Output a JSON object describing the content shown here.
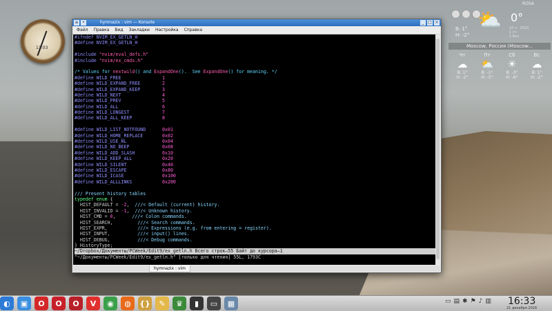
{
  "window": {
    "title": "hymnazix : vim — Konsole",
    "menu": [
      "Файл",
      "Правка",
      "Вид",
      "Закладки",
      "Настройка",
      "Справка"
    ],
    "tab_label": "hymnazix : vim"
  },
  "terminal": {
    "lines": [
      [
        [
          "#ifndef NVIM_EX_GETLN_H",
          "pp"
        ]
      ],
      [
        [
          "#define NVIM_EX_GETLN_H",
          "pp"
        ]
      ],
      [
        [
          "",
          ""
        ]
      ],
      [
        [
          "#include ",
          "pp"
        ],
        [
          "\"nvim/eval_defs.h\"",
          "fn"
        ]
      ],
      [
        [
          "#include ",
          "pp"
        ],
        [
          "\"nvim/ex_cmds.h\"",
          "fn"
        ]
      ],
      [
        [
          "",
          ""
        ]
      ],
      [
        [
          "/* Values for ",
          "comment"
        ],
        [
          "nextwild",
          "fn"
        ],
        [
          "() and ",
          "comment"
        ],
        [
          "ExpandOne",
          "fn"
        ],
        [
          "().  See ",
          "comment"
        ],
        [
          "ExpandOne",
          "fn"
        ],
        [
          "() for meaning. */",
          "comment"
        ]
      ],
      [
        [
          "#define WILD_FREE               ",
          "pp"
        ],
        [
          "1",
          "num"
        ]
      ],
      [
        [
          "#define WILD_EXPAND_FREE        ",
          "pp"
        ],
        [
          "2",
          "num"
        ]
      ],
      [
        [
          "#define WILD_EXPAND_KEEP        ",
          "pp"
        ],
        [
          "3",
          "num"
        ]
      ],
      [
        [
          "#define WILD_NEXT               ",
          "pp"
        ],
        [
          "4",
          "num"
        ]
      ],
      [
        [
          "#define WILD_PREV               ",
          "pp"
        ],
        [
          "5",
          "num"
        ]
      ],
      [
        [
          "#define WILD_ALL                ",
          "pp"
        ],
        [
          "6",
          "num"
        ]
      ],
      [
        [
          "#define WILD_LONGEST            ",
          "pp"
        ],
        [
          "7",
          "num"
        ]
      ],
      [
        [
          "#define WILD_ALL_KEEP           ",
          "pp"
        ],
        [
          "8",
          "num"
        ]
      ],
      [
        [
          "",
          ""
        ]
      ],
      [
        [
          "#define WILD_LIST_NOTFOUND      ",
          "pp"
        ],
        [
          "0x01",
          "num"
        ]
      ],
      [
        [
          "#define WILD_HOME_REPLACE       ",
          "pp"
        ],
        [
          "0x02",
          "num"
        ]
      ],
      [
        [
          "#define WILD_USE_NL             ",
          "pp"
        ],
        [
          "0x04",
          "num"
        ]
      ],
      [
        [
          "#define WILD_NO_BEEP            ",
          "pp"
        ],
        [
          "0x08",
          "num"
        ]
      ],
      [
        [
          "#define WILD_ADD_SLASH          ",
          "pp"
        ],
        [
          "0x10",
          "num"
        ]
      ],
      [
        [
          "#define WILD_KEEP_ALL           ",
          "pp"
        ],
        [
          "0x20",
          "num"
        ]
      ],
      [
        [
          "#define WILD_SILENT             ",
          "pp"
        ],
        [
          "0x40",
          "num"
        ]
      ],
      [
        [
          "#define WILD_ESCAPE             ",
          "pp"
        ],
        [
          "0x80",
          "num"
        ]
      ],
      [
        [
          "#define WILD_ICASE              ",
          "pp"
        ],
        [
          "0x100",
          "num"
        ]
      ],
      [
        [
          "#define WILD_ALLLINKS           ",
          "pp"
        ],
        [
          "0x200",
          "num"
        ]
      ],
      [
        [
          "",
          ""
        ]
      ],
      [
        [
          "/// Present history tables",
          "doc"
        ]
      ],
      [
        [
          "typedef ",
          "type"
        ],
        [
          "enum ",
          "type"
        ],
        [
          "{",
          "id"
        ]
      ],
      [
        [
          "  HIST_DEFAULT = ",
          "id"
        ],
        [
          "-2",
          "num"
        ],
        [
          ",  ",
          "id"
        ],
        [
          "///< Default (current) history.",
          "doc"
        ]
      ],
      [
        [
          "  HIST_INVALID = ",
          "id"
        ],
        [
          "-1",
          "num"
        ],
        [
          ",  ",
          "id"
        ],
        [
          "///< Unknown history.",
          "doc"
        ]
      ],
      [
        [
          "  HIST_CMD = ",
          "id"
        ],
        [
          "0",
          "num"
        ],
        [
          ",      ",
          "id"
        ],
        [
          "///< Colon commands.",
          "doc"
        ]
      ],
      [
        [
          "  HIST_SEARCH,         ",
          "id"
        ],
        [
          "///< Search commands.",
          "doc"
        ]
      ],
      [
        [
          "  HIST_EXPR,           ",
          "id"
        ],
        [
          "///< Expressions (e.g. from entering = register).",
          "doc"
        ]
      ],
      [
        [
          "  HIST_INPUT,          ",
          "id"
        ],
        [
          "///< input() lines.",
          "doc"
        ]
      ],
      [
        [
          "  HIST_DEBUG,          ",
          "id"
        ],
        [
          "///< Debug commands.",
          "doc"
        ]
      ],
      [
        [
          "} HistoryType;",
          "id"
        ]
      ]
    ],
    "status_line": "~/Dropbox/Документы/PCWeek/Edit9/ex_getln.h Всего строк—55 Байт до курсора—1",
    "cmd_line": "\"~/Документы/PCWeek/Edit9/ex_getln.h\" [только для чтения] 55L, 1793C"
  },
  "weather": {
    "current_temp": "0°",
    "temp_high": "В: 1°",
    "temp_low": "Н: -2°",
    "meta": [
      "10 ч · 2016",
      "1 ст.",
      "1 бал"
    ],
    "city": "Moscow, Россия (Moscow...",
    "days": [
      {
        "name": "Чт",
        "icon": "☁",
        "high": "В: 1°",
        "low": "Н: -2°"
      },
      {
        "name": "Пт",
        "icon": "⛅",
        "high": "В: -1°",
        "low": "Н: -5°"
      },
      {
        "name": "Сб",
        "icon": "☀",
        "high": "В: -3°",
        "low": "Н: -6°"
      },
      {
        "name": "Вс",
        "icon": "☁",
        "high": "В: 1°",
        "low": "Н: -2°"
      }
    ]
  },
  "corner_label": "ROSA",
  "clock_widget_label": "13:03",
  "taskbar": {
    "apps": [
      {
        "name": "start-menu",
        "glyph": "◐",
        "color": "#2d7bd6"
      },
      {
        "name": "file-manager",
        "glyph": "▣",
        "color": "#3b8fe0"
      },
      {
        "name": "opera",
        "glyph": "O",
        "color": "#d42828"
      },
      {
        "name": "opera-2",
        "glyph": "O",
        "color": "#c8202a"
      },
      {
        "name": "opera-3",
        "glyph": "O",
        "color": "#b8202a"
      },
      {
        "name": "vivaldi",
        "glyph": "V",
        "color": "#e0302e"
      },
      {
        "name": "chrome",
        "glyph": "◉",
        "color": "#3aa04a"
      },
      {
        "name": "firefox",
        "glyph": "◍",
        "color": "#e86a1a"
      },
      {
        "name": "geany",
        "glyph": "{}",
        "color": "#d0a040"
      },
      {
        "name": "editor",
        "glyph": "✎",
        "color": "#e4b84a"
      },
      {
        "name": "chess",
        "glyph": "♛",
        "color": "#3a8a3a"
      },
      {
        "name": "terminal",
        "glyph": "▮",
        "color": "#333333"
      },
      {
        "name": "konsole",
        "glyph": "▭",
        "color": "#444444"
      },
      {
        "name": "screenshot",
        "glyph": "▦",
        "color": "#6a88a8"
      }
    ],
    "time": "16:33",
    "date": "21 декабря 2016"
  }
}
